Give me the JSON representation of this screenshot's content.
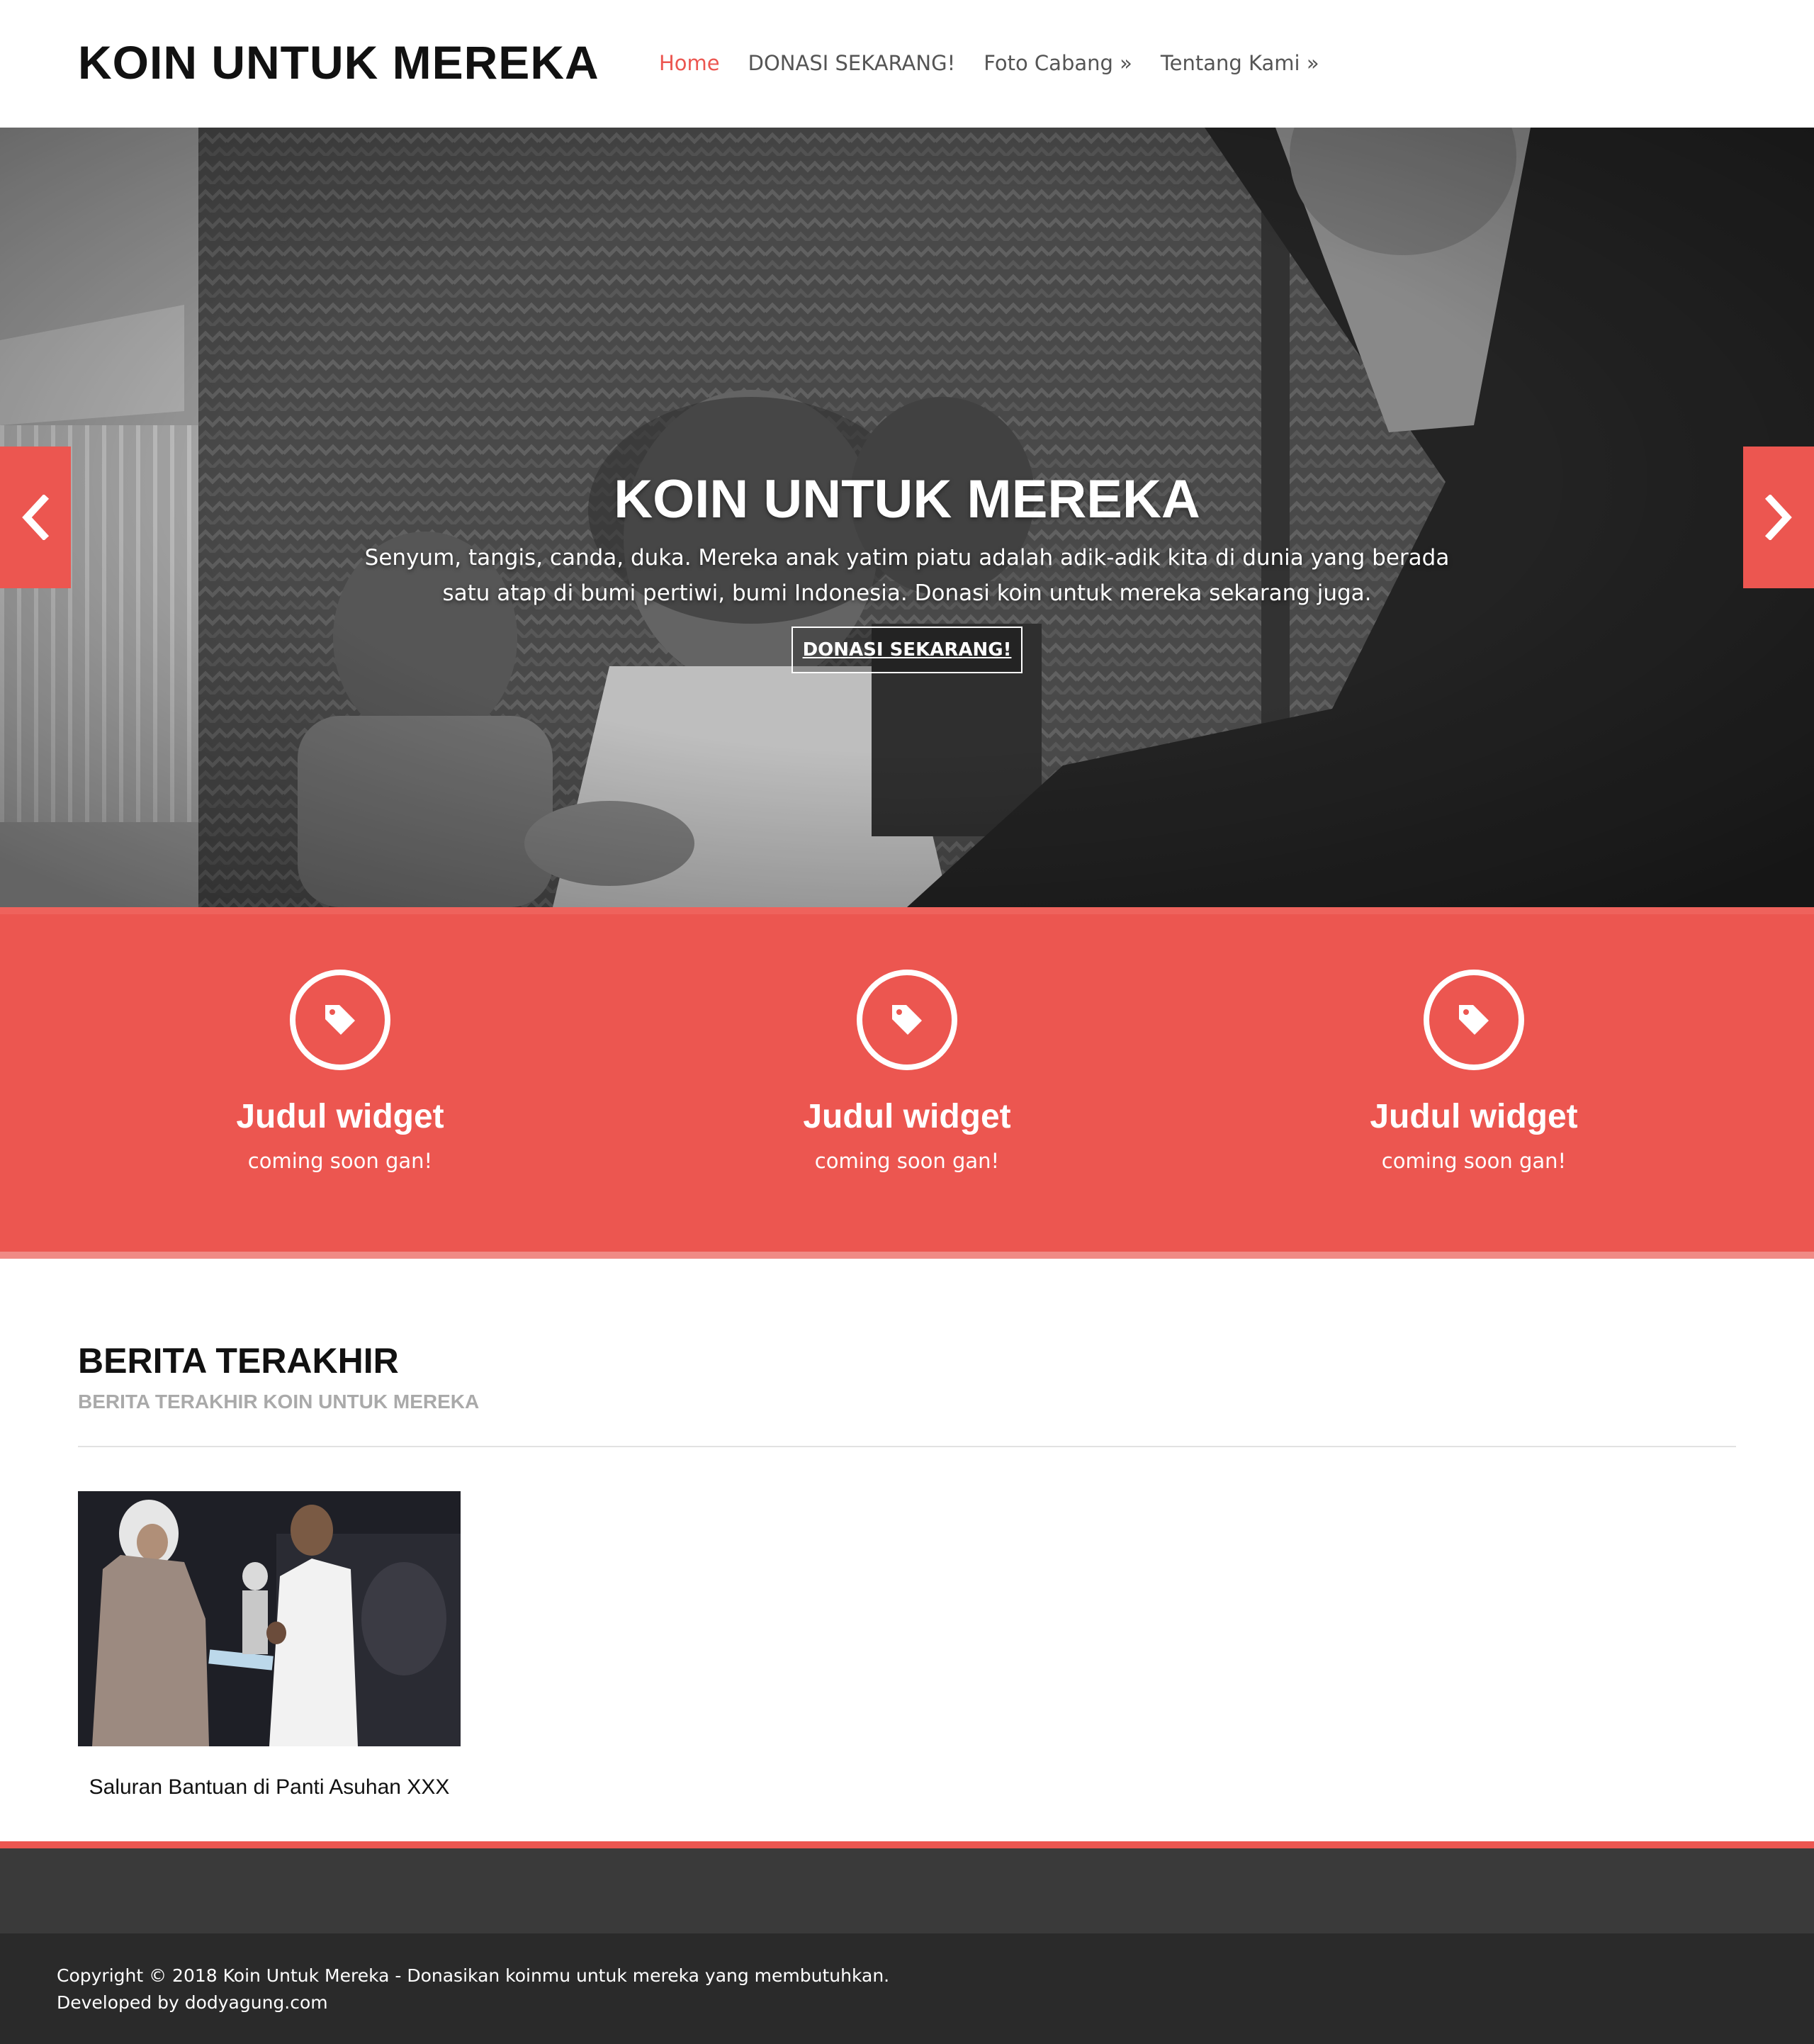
{
  "site": {
    "title": "KOIN UNTUK MEREKA"
  },
  "nav": [
    {
      "label": "Home",
      "active": true
    },
    {
      "label": "DONASI SEKARANG!",
      "active": false
    },
    {
      "label": "Foto Cabang »",
      "active": false
    },
    {
      "label": "Tentang Kami »",
      "active": false
    }
  ],
  "hero": {
    "title": "KOIN UNTUK MEREKA",
    "text": "Senyum, tangis, canda, duka. Mereka anak yatim piatu adalah adik-adik kita di dunia yang berada satu atap di bumi pertiwi, bumi Indonesia. Donasi koin untuk mereka sekarang juga.",
    "button": "DONASI SEKARANG!",
    "prev_icon": "chevron-left-icon",
    "next_icon": "chevron-right-icon"
  },
  "widgets": [
    {
      "icon": "tag-icon",
      "title": "Judul widget",
      "text": "coming soon gan!"
    },
    {
      "icon": "tag-icon",
      "title": "Judul widget",
      "text": "coming soon gan!"
    },
    {
      "icon": "tag-icon",
      "title": "Judul widget",
      "text": "coming soon gan!"
    }
  ],
  "news": {
    "title": "BERITA TERAKHIR",
    "subtitle": "BERITA TERAKHIR KOIN UNTUK MEREKA",
    "posts": [
      {
        "caption": "Saluran Bantuan di Panti Asuhan XXX"
      }
    ]
  },
  "footer": {
    "copyright": "Copyright © 2018 Koin Untuk Mereka - Donasikan koinmu untuk mereka yang membutuhkan.",
    "developed": "Developed by dodyagung.com"
  },
  "colors": {
    "accent": "#ec5650",
    "footer_top": "#3a3a3a",
    "footer_bottom": "#2a2a2a"
  }
}
